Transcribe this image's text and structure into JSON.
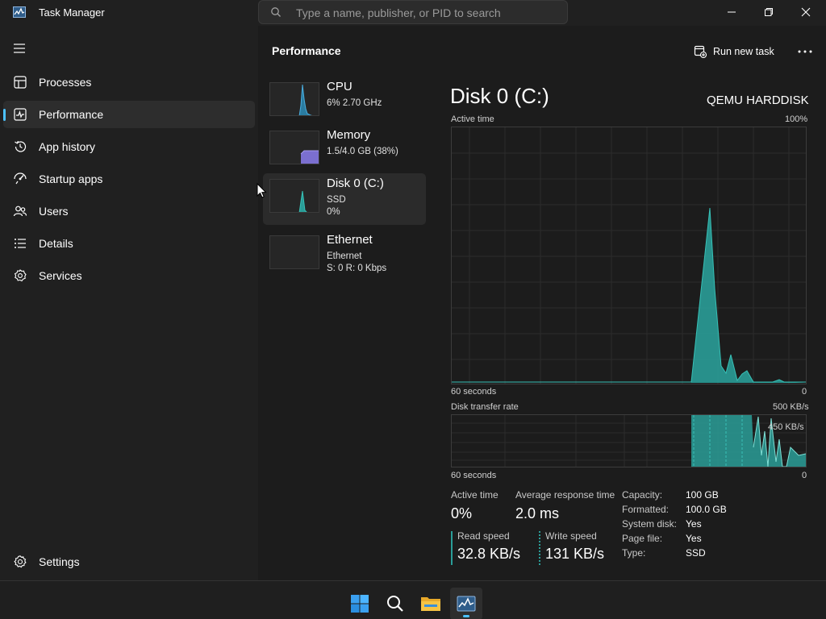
{
  "window": {
    "title": "Task Manager",
    "search_placeholder": "Type a name, publisher, or PID to search"
  },
  "sidebar": {
    "items": [
      {
        "label": "Processes",
        "icon": "processes-icon"
      },
      {
        "label": "Performance",
        "icon": "performance-icon",
        "active": true
      },
      {
        "label": "App history",
        "icon": "history-icon"
      },
      {
        "label": "Startup apps",
        "icon": "startup-icon"
      },
      {
        "label": "Users",
        "icon": "users-icon"
      },
      {
        "label": "Details",
        "icon": "details-icon"
      },
      {
        "label": "Services",
        "icon": "services-icon"
      }
    ],
    "settings_label": "Settings"
  },
  "header": {
    "title": "Performance",
    "run_new_task": "Run new task"
  },
  "devices": [
    {
      "name": "CPU",
      "line1": "6% 2.70 GHz",
      "line2": ""
    },
    {
      "name": "Memory",
      "line1": "1.5/4.0 GB (38%)",
      "line2": ""
    },
    {
      "name": "Disk 0 (C:)",
      "line1": "SSD",
      "line2": "0%",
      "selected": true
    },
    {
      "name": "Ethernet",
      "line1": "Ethernet",
      "line2": "S: 0 R: 0 Kbps"
    }
  ],
  "detail": {
    "title": "Disk 0 (C:)",
    "model": "QEMU HARDDISK",
    "active_time_graph": {
      "label": "Active time",
      "max_label": "100%",
      "x_left": "60 seconds",
      "x_right": "0"
    },
    "transfer_graph": {
      "label": "Disk transfer rate",
      "max_label": "500 KB/s",
      "marker_label": "450 KB/s",
      "x_left": "60 seconds",
      "x_right": "0"
    },
    "stats": {
      "active_time_label": "Active time",
      "active_time_value": "0%",
      "avg_response_label": "Average response time",
      "avg_response_value": "2.0 ms",
      "read_speed_label": "Read speed",
      "read_speed_value": "32.8 KB/s",
      "write_speed_label": "Write speed",
      "write_speed_value": "131 KB/s"
    },
    "info": [
      {
        "key": "Capacity:",
        "value": "100 GB"
      },
      {
        "key": "Formatted:",
        "value": "100.0 GB"
      },
      {
        "key": "System disk:",
        "value": "Yes"
      },
      {
        "key": "Page file:",
        "value": "Yes"
      },
      {
        "key": "Type:",
        "value": "SSD"
      }
    ]
  },
  "taskbar": {
    "items": [
      "start-icon",
      "search-icon",
      "file-explorer-icon",
      "task-manager-icon"
    ]
  },
  "colors": {
    "accent": "#4cc2ff",
    "disk_fill": "#2a9d98",
    "disk_line": "#37c0b6",
    "cpu_fill": "#2b8cb7",
    "memory_fill": "#7b6fd0",
    "ethernet_line": "#c2507a"
  }
}
